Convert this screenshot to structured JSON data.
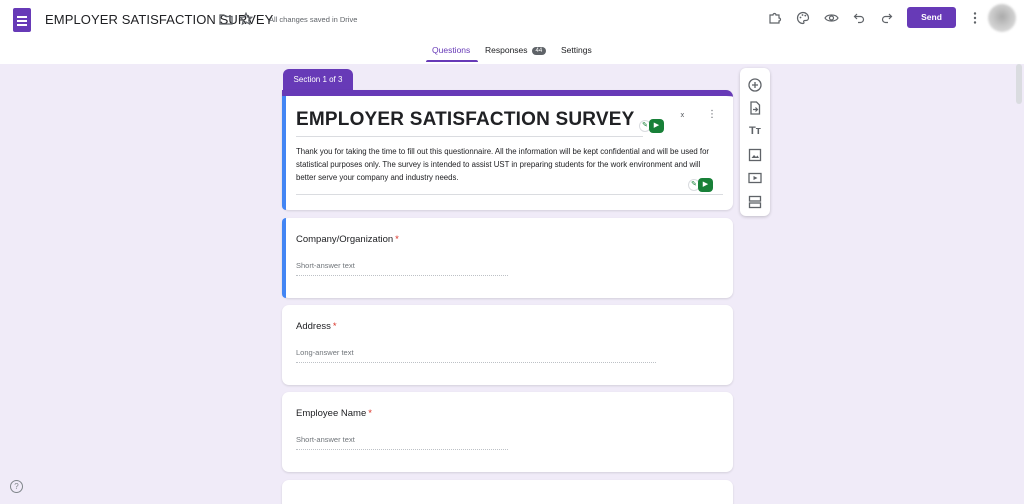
{
  "header": {
    "title": "EMPLOYER SATISFACTION SURVEY",
    "saved_status": "All changes saved in Drive",
    "send_label": "Send",
    "icons": [
      "folder-icon",
      "star-icon",
      "addon-icon",
      "palette-icon",
      "preview-eye-icon",
      "undo-icon",
      "redo-icon",
      "more-vert-icon"
    ]
  },
  "tabs": [
    {
      "label": "Questions",
      "active": true
    },
    {
      "label": "Responses",
      "badge": "44"
    },
    {
      "label": "Settings"
    }
  ],
  "section": {
    "label": "Section 1 of 3"
  },
  "form": {
    "title": "EMPLOYER SATISFACTION SURVEY",
    "description": "Thank you for taking the time to fill out this questionnaire. All the information will be kept confidential and will be used for statistical purposes only. The survey is intended to assist UST in preparing students for the work environment and will better serve your company and industry needs."
  },
  "questions": [
    {
      "label": "Company/Organization",
      "required_mark": "*",
      "placeholder": "Short-answer text"
    },
    {
      "label": "Address",
      "required_mark": "*",
      "placeholder": "Long-answer text"
    },
    {
      "label": "Employee Name",
      "required_mark": "*",
      "placeholder": "Short-answer text"
    }
  ],
  "toolbar": {
    "icons": [
      "add-question-icon",
      "import-questions-icon",
      "add-title-icon",
      "add-image-icon",
      "add-video-icon",
      "add-section-icon"
    ]
  },
  "colors": {
    "accent": "#673ab7",
    "active_edge": "#4285f4",
    "background": "#f0ebf8",
    "required": "#d93025"
  }
}
